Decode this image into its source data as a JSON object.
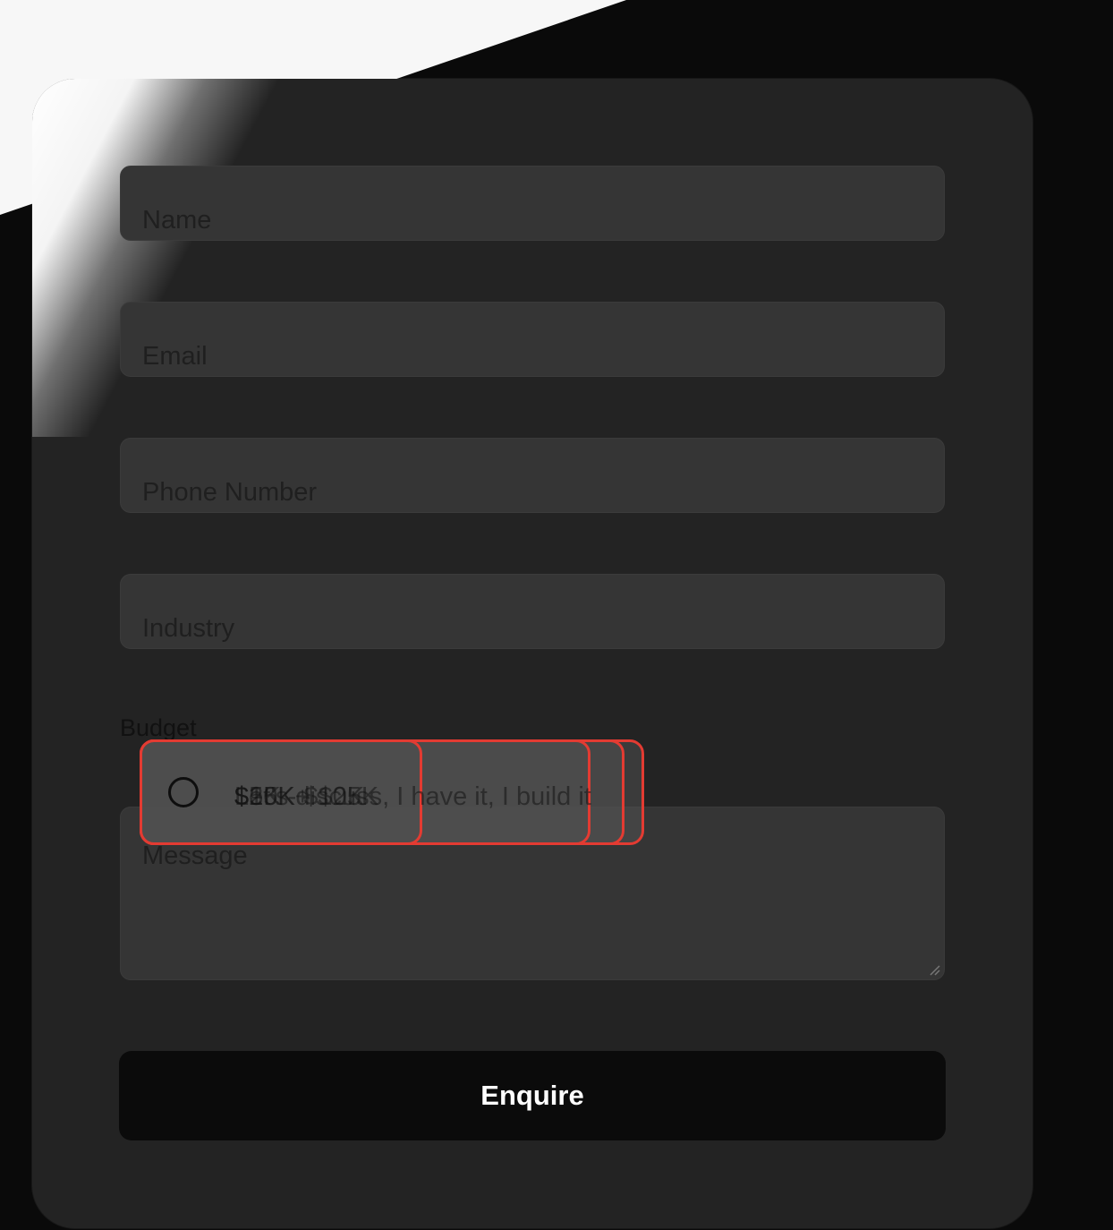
{
  "form": {
    "name_placeholder": "Name",
    "email_placeholder": "Email",
    "phone_placeholder": "Phone Number",
    "industry_placeholder": "Industry",
    "message_placeholder": "Message",
    "budget_label": "Budget",
    "budget_options": [
      {
        "label": "$5K - $10K"
      },
      {
        "label": "$10K - $25K"
      },
      {
        "label": "$25K+"
      },
      {
        "label": "Let's discuss, I have it, I build it"
      }
    ],
    "submit_label": "Enquire"
  },
  "colors": {
    "card_bg": "#232323",
    "field_bg": "#353535",
    "option_border": "#e33b32",
    "button_bg": "#0b0b0b",
    "button_text": "#ffffff"
  }
}
